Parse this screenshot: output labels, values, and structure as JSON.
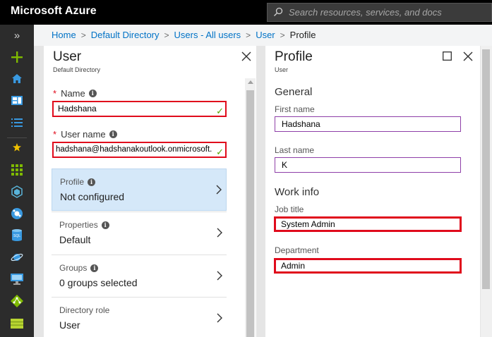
{
  "app": {
    "brand": "Microsoft Azure",
    "search_placeholder": "Search resources, services, and docs"
  },
  "breadcrumb": {
    "items": [
      "Home",
      "Default Directory",
      "Users - All users",
      "User"
    ],
    "current": "Profile"
  },
  "rail": {
    "collapse_glyph": "»",
    "icons": [
      "plus-icon",
      "home-icon",
      "dashboard-icon",
      "all-services-icon",
      "favorites-star-icon",
      "all-resources-icon",
      "resource-groups-icon",
      "app-services-icon",
      "sql-databases-icon",
      "cosmos-db-icon",
      "virtual-machines-icon",
      "load-balancers-icon",
      "storage-accounts-icon"
    ]
  },
  "user_blade": {
    "title": "User",
    "subtitle": "Default Directory",
    "name_label": "Name",
    "name_value": "Hadshana",
    "username_label": "User name",
    "username_value": "hadshana@hadshanakoutlook.onmicrosoft.",
    "nav": [
      {
        "label": "Profile",
        "value": "Not configured",
        "info": true,
        "active": true
      },
      {
        "label": "Properties",
        "value": "Default",
        "info": true,
        "active": false
      },
      {
        "label": "Groups",
        "value": "0 groups selected",
        "info": true,
        "active": false
      },
      {
        "label": "Directory role",
        "value": "User",
        "info": false,
        "active": false
      }
    ]
  },
  "profile_blade": {
    "title": "Profile",
    "subtitle": "User",
    "general_heading": "General",
    "first_name_label": "First name",
    "first_name_value": "Hadshana",
    "last_name_label": "Last name",
    "last_name_value": "K",
    "work_heading": "Work info",
    "job_title_label": "Job title",
    "job_title_value": "System Admin",
    "department_label": "Department",
    "department_value": "Admin"
  },
  "colors": {
    "accent": "#0072c6",
    "highlight_red": "#e00b1c",
    "input_purple": "#8e3fa8",
    "valid_green": "#57a300",
    "active_nav": "#d5e8f9"
  }
}
